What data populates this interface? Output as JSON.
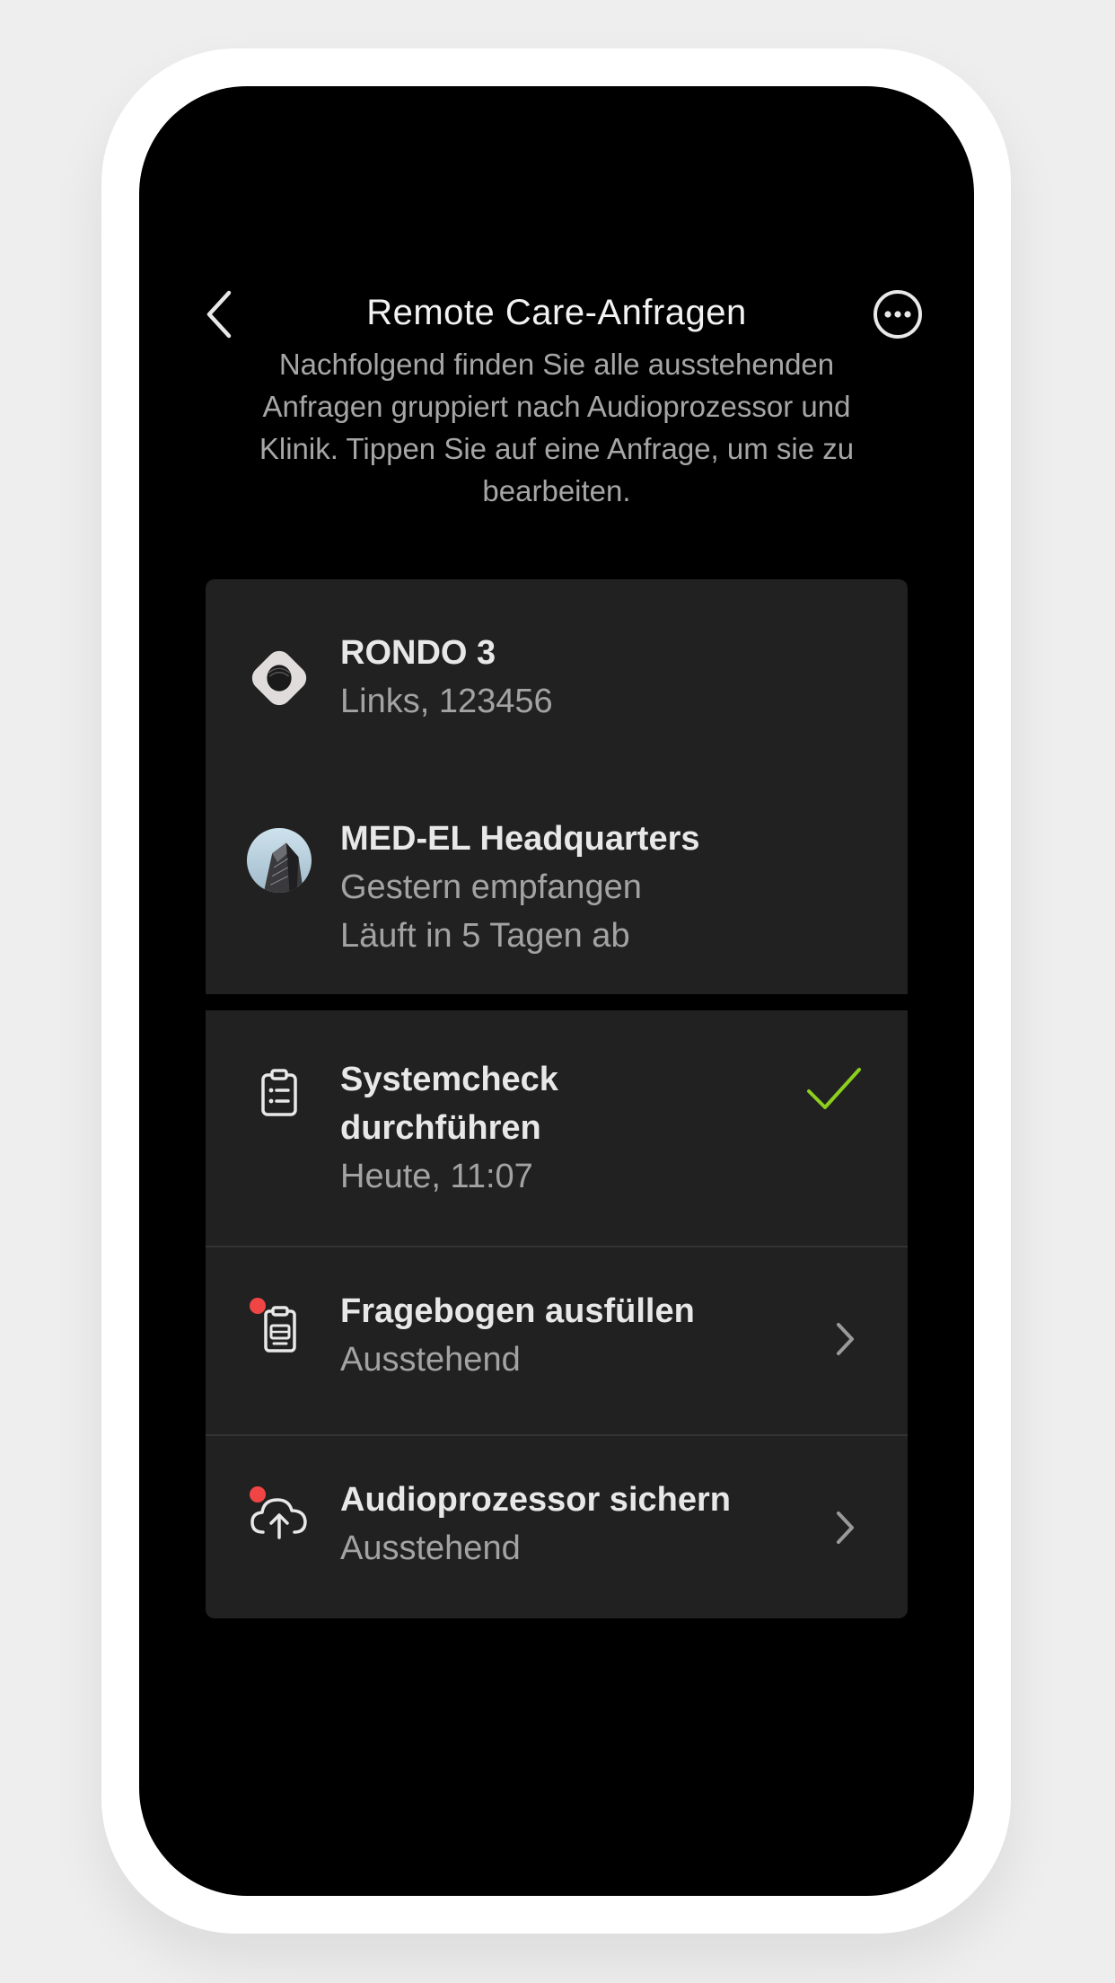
{
  "nav": {
    "title": "Remote Care-Anfragen"
  },
  "intro": {
    "text": "Nachfolgend finden Sie alle ausstehenden Anfragen gruppiert nach Audioprozessor und Klinik. Tippen Sie auf eine Anfrage, um sie zu bearbeiten."
  },
  "device": {
    "name": "RONDO 3",
    "detail": "Links, 123456",
    "icon": "audio-processor-icon"
  },
  "clinic": {
    "name": "MED-EL Headquarters",
    "received": "Gestern empfangen",
    "expires": "Läuft in 5 Tagen ab",
    "icon": "clinic-avatar"
  },
  "tasks": [
    {
      "title_line1": "Systemcheck",
      "title_line2": "durchführen",
      "status": "Heute, 11:07",
      "icon": "clipboard-checklist-icon",
      "state": "done"
    },
    {
      "title": "Fragebogen ausfüllen",
      "status": "Ausstehend",
      "icon": "questionnaire-icon",
      "state": "pending"
    },
    {
      "title": "Audioprozessor sichern",
      "status": "Ausstehend",
      "icon": "cloud-upload-icon",
      "state": "pending"
    }
  ],
  "colors": {
    "background": "#000000",
    "card": "#212121",
    "accent_check": "#8ccf1e",
    "notification_dot": "#f04545"
  }
}
